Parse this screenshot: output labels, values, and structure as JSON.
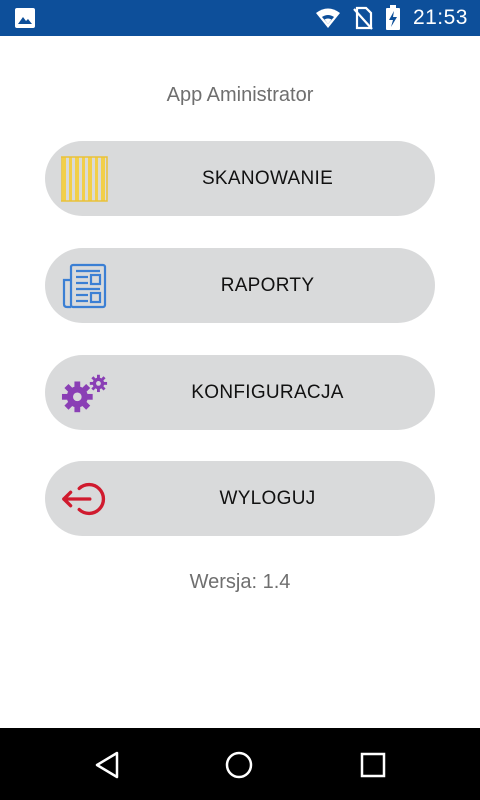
{
  "status_bar": {
    "time": "21:53",
    "icons": [
      "image-notification-icon",
      "wifi-icon",
      "no-sim-icon",
      "battery-charging-icon"
    ],
    "background_color": "#0d4f9a"
  },
  "app": {
    "title": "App Aministrator",
    "version_text": "Wersja: 1.4"
  },
  "menu": {
    "button_color": "#d9dadb",
    "items": [
      {
        "label": "SKANOWANIE",
        "icon": "barcode-icon",
        "icon_color": "#f2cf4a"
      },
      {
        "label": "RAPORTY",
        "icon": "report-icon",
        "icon_color": "#3b7fd4"
      },
      {
        "label": "KONFIGURACJA",
        "icon": "gears-icon",
        "icon_color": "#8a3fb5"
      },
      {
        "label": "WYLOGUJ",
        "icon": "logout-icon",
        "icon_color": "#d01a2e"
      }
    ]
  },
  "nav_bar": {
    "buttons": [
      "back-icon",
      "home-icon",
      "recents-icon"
    ]
  }
}
